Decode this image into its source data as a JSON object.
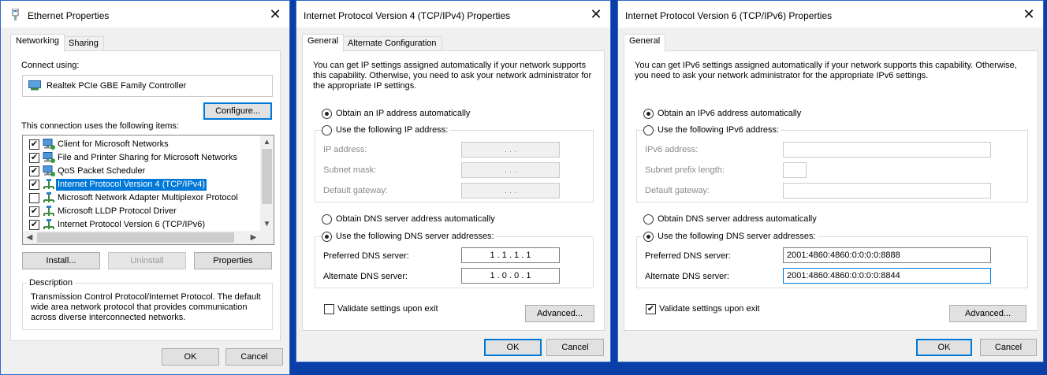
{
  "ethernet": {
    "title": "Ethernet Properties",
    "tabs": [
      "Networking",
      "Sharing"
    ],
    "connect_using_label": "Connect using:",
    "adapter_name": "Realtek PCIe GBE Family Controller",
    "configure_button": "Configure...",
    "items_label": "This connection uses the following items:",
    "items": [
      {
        "label": "Client for Microsoft Networks",
        "checked": true,
        "icon": "network-client-icon"
      },
      {
        "label": "File and Printer Sharing for Microsoft Networks",
        "checked": true,
        "icon": "network-service-icon"
      },
      {
        "label": "QoS Packet Scheduler",
        "checked": true,
        "icon": "network-service-icon"
      },
      {
        "label": "Internet Protocol Version 4 (TCP/IPv4)",
        "checked": true,
        "icon": "protocol-icon",
        "selected": true
      },
      {
        "label": "Microsoft Network Adapter Multiplexor Protocol",
        "checked": false,
        "icon": "protocol-icon"
      },
      {
        "label": "Microsoft LLDP Protocol Driver",
        "checked": true,
        "icon": "protocol-icon"
      },
      {
        "label": "Internet Protocol Version 6 (TCP/IPv6)",
        "checked": true,
        "icon": "protocol-icon"
      }
    ],
    "install_button": "Install...",
    "uninstall_button": "Uninstall",
    "properties_button": "Properties",
    "description_label": "Description",
    "description_text": "Transmission Control Protocol/Internet Protocol. The default wide area network protocol that provides communication across diverse interconnected networks.",
    "ok_button": "OK",
    "cancel_button": "Cancel"
  },
  "ipv4": {
    "title": "Internet Protocol Version 4 (TCP/IPv4) Properties",
    "tabs": [
      "General",
      "Alternate Configuration"
    ],
    "intro": "You can get IP settings assigned automatically if your network supports this capability. Otherwise, you need to ask your network administrator for the appropriate IP settings.",
    "obtain_ip_auto": "Obtain an IP address automatically",
    "use_following_ip": "Use the following IP address:",
    "ip_address_label": "IP address:",
    "subnet_mask_label": "Subnet mask:",
    "default_gateway_label": "Default gateway:",
    "empty_ip": ".       .       .",
    "obtain_dns_auto": "Obtain DNS server address automatically",
    "use_following_dns": "Use the following DNS server addresses:",
    "preferred_dns_label": "Preferred DNS server:",
    "preferred_dns_value": "1  .  1  .  1  .  1",
    "alternate_dns_label": "Alternate DNS server:",
    "alternate_dns_value": "1  .  0  .  0  .  1",
    "validate_label": "Validate settings upon exit",
    "validate_checked": false,
    "advanced_button": "Advanced...",
    "ok_button": "OK",
    "cancel_button": "Cancel"
  },
  "ipv6": {
    "title": "Internet Protocol Version 6 (TCP/IPv6) Properties",
    "tabs": [
      "General"
    ],
    "intro": "You can get IPv6 settings assigned automatically if your network supports this capability. Otherwise, you need to ask your network administrator for the appropriate IPv6 settings.",
    "obtain_ip_auto": "Obtain an IPv6 address automatically",
    "use_following_ip": "Use the following IPv6 address:",
    "ip_address_label": "IPv6 address:",
    "prefix_label": "Subnet prefix length:",
    "default_gateway_label": "Default gateway:",
    "obtain_dns_auto": "Obtain DNS server address automatically",
    "use_following_dns": "Use the following DNS server addresses:",
    "preferred_dns_label": "Preferred DNS server:",
    "preferred_dns_value": "2001:4860:4860:0:0:0:0:8888",
    "alternate_dns_label": "Alternate DNS server:",
    "alternate_dns_value": "2001:4860:4860:0:0:0:0:8844",
    "validate_label": "Validate settings upon exit",
    "validate_checked": true,
    "advanced_button": "Advanced...",
    "ok_button": "OK",
    "cancel_button": "Cancel"
  },
  "colors": {
    "desktop": "#0b3fa8",
    "selection": "#0078d7",
    "window_border": "#2f68c8"
  }
}
